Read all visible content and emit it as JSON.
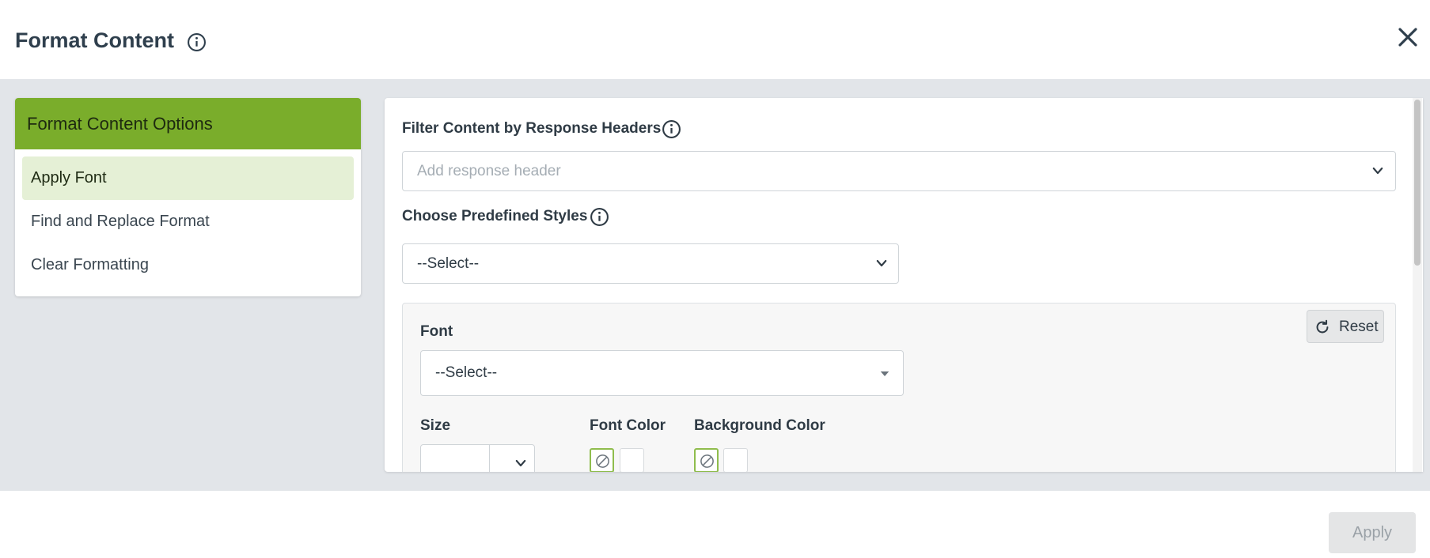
{
  "dialog": {
    "title": "Format Content"
  },
  "sidebar": {
    "heading": "Format Content Options",
    "items": [
      {
        "label": "Apply Font",
        "active": true
      },
      {
        "label": "Find and Replace Format",
        "active": false
      },
      {
        "label": "Clear Formatting",
        "active": false
      }
    ]
  },
  "main": {
    "filter": {
      "label": "Filter Content by Response Headers",
      "placeholder": "Add response header"
    },
    "predefined": {
      "label": "Choose Predefined Styles",
      "value": "--Select--"
    },
    "font_section": {
      "reset_label": "Reset",
      "font_label": "Font",
      "font_value": "--Select--",
      "size_label": "Size",
      "size_value": "",
      "font_color_label": "Font Color",
      "background_color_label": "Background Color"
    }
  },
  "footer": {
    "apply_label": "Apply"
  },
  "colors": {
    "accent": "#7aad2b",
    "active_item_bg": "#e5f0d6",
    "backdrop": "#e2e5e9"
  }
}
